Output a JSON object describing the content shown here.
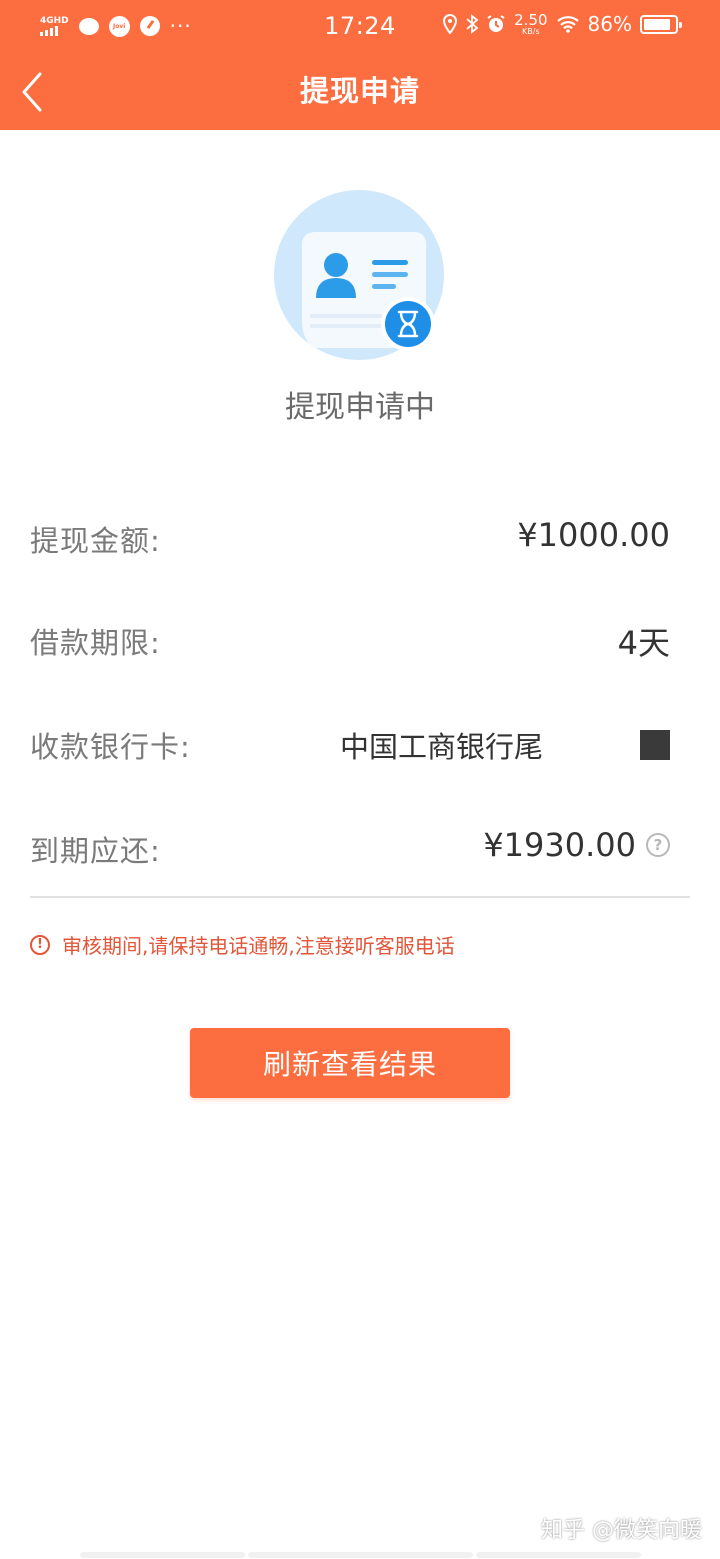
{
  "status_bar": {
    "network": "4GHD",
    "time": "17:24",
    "speed_value": "2.50",
    "speed_unit": "KB/s",
    "battery_percent": "86%",
    "battery_level": 0.86,
    "more": "···",
    "jovi": "Jovi"
  },
  "header": {
    "title": "提现申请",
    "back_icon": "chevron-left-icon"
  },
  "status": {
    "label": "提现申请中",
    "icon": "id-card-hourglass-icon"
  },
  "details": [
    {
      "label": "提现金额:",
      "value": "¥1000.00"
    },
    {
      "label": "借款期限:",
      "value": "4天"
    },
    {
      "label": "收款银行卡:",
      "value": "中国工商银行尾"
    },
    {
      "label": "到期应还:",
      "value": "¥1930.00",
      "help_icon": "question-circle-icon"
    }
  ],
  "notice": {
    "icon": "exclamation-circle-icon",
    "text": "审核期间,请保持电话通畅,注意接听客服电话"
  },
  "actions": {
    "refresh_label": "刷新查看结果"
  },
  "watermark": "知乎 @微笑向暖",
  "colors": {
    "brand": "#fc6d40",
    "warning": "#e2563a",
    "icon_blue": "#1e8ee6"
  }
}
